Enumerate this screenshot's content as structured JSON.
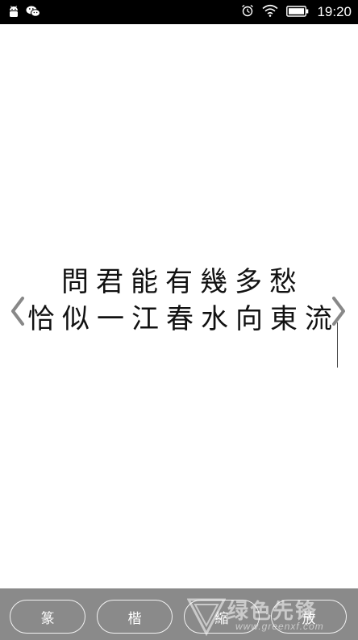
{
  "status_bar": {
    "time": "19:20",
    "left_icons": [
      "android-icon",
      "wechat-icon"
    ],
    "right_icons": [
      "alarm-icon",
      "wifi-icon",
      "battery-icon"
    ]
  },
  "poem": {
    "line_1": "問君能有幾多愁",
    "line_2": "恰似一江春水向東流"
  },
  "toolbar": {
    "buttons": [
      {
        "label": "篆"
      },
      {
        "label": "楷"
      },
      {
        "label": "縮"
      },
      {
        "label": "放"
      }
    ]
  },
  "watermark": {
    "text": "绿色先锋",
    "url": "www.greenxf.com"
  },
  "colors": {
    "status_bar_bg": "#000000",
    "toolbar_bg": "#8a8a8a",
    "button_border": "#f2f2f2",
    "text": "#111111"
  }
}
